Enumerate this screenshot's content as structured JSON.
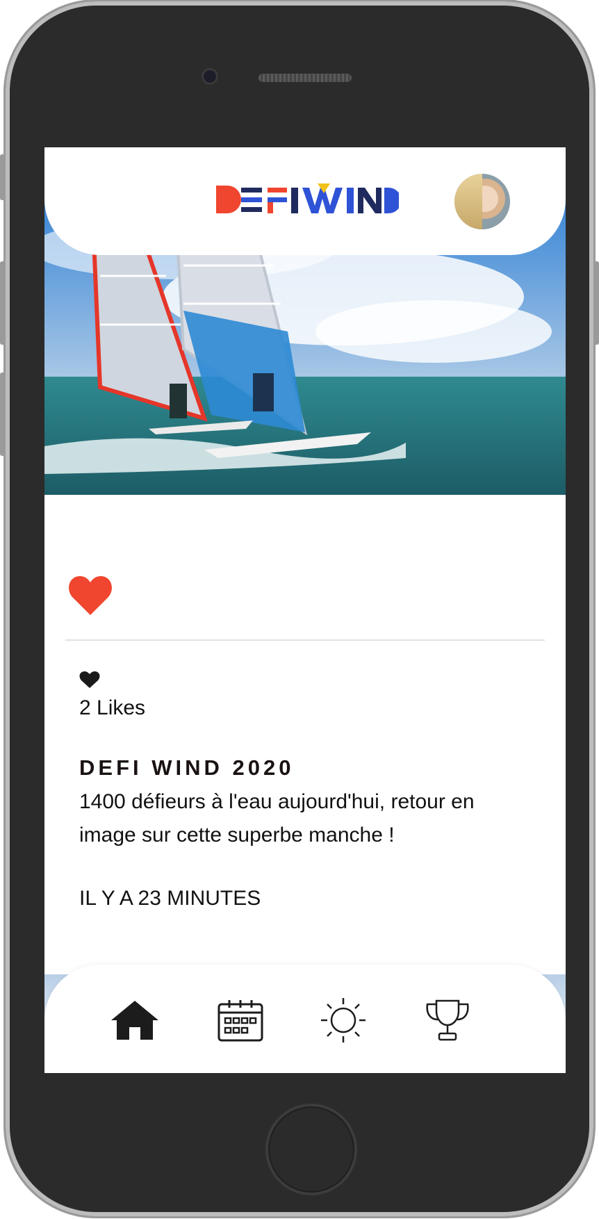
{
  "app": {
    "logo_text": "DEFIWIND"
  },
  "user": {
    "avatar": "profile-avatar"
  },
  "post": {
    "likes": "2 Likes",
    "title": "DEFI WIND 2020",
    "caption": "1400 défieurs à l'eau aujourd'hui, retour en image sur cette superbe manche !",
    "time": "IL Y A 23 MINUTES"
  },
  "icons": {
    "like": "heart-icon",
    "nav": [
      "home-icon",
      "calendar-icon",
      "sun-icon",
      "trophy-icon"
    ]
  },
  "colors": {
    "accent_red": "#f0452e",
    "brand_navy": "#1f2b5e",
    "brand_blue": "#2f53d6",
    "brand_yellow": "#f3c21a"
  }
}
